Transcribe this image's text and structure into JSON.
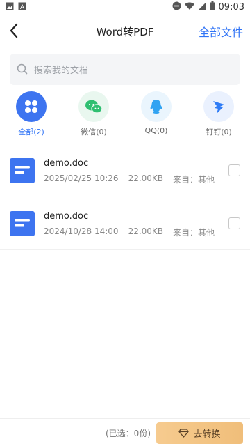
{
  "status_bar": {
    "time": "09:03"
  },
  "header": {
    "title": "Word转PDF",
    "all_files_label": "全部文件"
  },
  "search": {
    "placeholder": "搜索我的文档"
  },
  "filters": [
    {
      "label": "全部(2)",
      "color": "#3d74f0"
    },
    {
      "label": "微信(0)",
      "color": "#2fbf71"
    },
    {
      "label": "QQ(0)",
      "color": "#31a3f2"
    },
    {
      "label": "钉钉(0)",
      "color": "#2f7cf6"
    }
  ],
  "files": [
    {
      "name": "demo.doc",
      "date": "2025/02/25 10:26",
      "size": "22.00KB",
      "source": "来自：其他"
    },
    {
      "name": "demo.doc",
      "date": "2024/10/28 14:00",
      "size": "22.00KB",
      "source": "来自：其他"
    }
  ],
  "footer": {
    "selected_text": "(已选：0份)",
    "convert_label": "去转换"
  }
}
